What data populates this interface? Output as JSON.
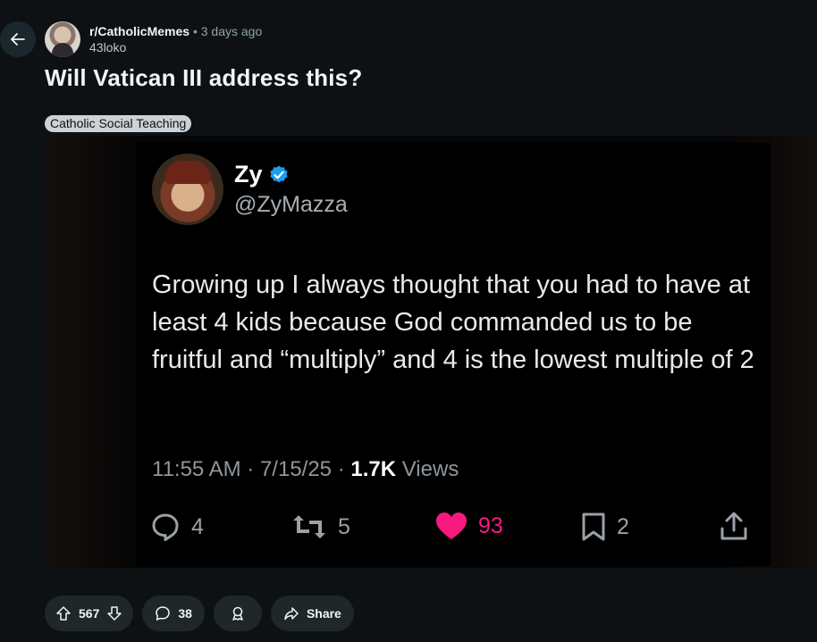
{
  "post": {
    "subreddit": "r/CatholicMemes",
    "separator": "•",
    "age": "3 days ago",
    "author": "43loko",
    "title": "Will Vatican III address this?",
    "flair": "Catholic Social Teaching"
  },
  "tweet": {
    "name": "Zy",
    "handle": "@ZyMazza",
    "text": "Growing up I always thought that you had to have at least 4 kids because God commanded us to be fruitful and “multiply” and 4 is the lowest multiple of 2",
    "time": "11:55 AM · 7/15/25 · ",
    "views_count": "1.7K",
    "views_label": " Views",
    "replies": "4",
    "retweets": "5",
    "likes": "93",
    "bookmarks": "2",
    "verified_color": "#1d9bf0",
    "like_color": "#f91880"
  },
  "actions": {
    "votes": "567",
    "comments": "38",
    "share": "Share"
  },
  "icons": [
    "back-arrow-icon",
    "verified-badge-icon",
    "reply-icon",
    "retweet-icon",
    "heart-icon",
    "bookmark-icon",
    "share-icon",
    "upvote-icon",
    "downvote-icon",
    "comment-icon",
    "award-icon"
  ]
}
